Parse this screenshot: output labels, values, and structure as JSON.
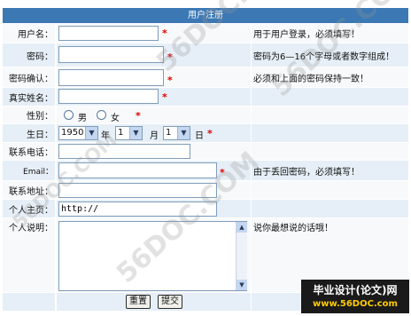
{
  "form": {
    "title": "用户注册"
  },
  "rows": {
    "username": {
      "label": "用户名：",
      "value": "",
      "required": "*",
      "note": "用于用户登录，必须填写！"
    },
    "password": {
      "label": "密码：",
      "value": "",
      "required": "*",
      "note": "密码为6—16个字母或者数字组成！"
    },
    "confirm": {
      "label": "密码确认：",
      "value": "",
      "required": "*",
      "note": "必须和上面的密码保持一致！"
    },
    "realname": {
      "label": "真实姓名：",
      "value": "",
      "required": "*"
    },
    "gender": {
      "label": "性别：",
      "male": "男",
      "female": "女",
      "required": "*"
    },
    "birthday": {
      "label": "生日：",
      "year": "1950",
      "year_unit": "年",
      "month": "1",
      "month_unit": "月",
      "day": "1",
      "day_unit": "日",
      "required": "*"
    },
    "phone": {
      "label": "联系电话：",
      "value": ""
    },
    "email": {
      "label": "Email：",
      "value": "",
      "required": "*",
      "note": "由于丢回密码，必须填写！"
    },
    "address": {
      "label": "联系地址：",
      "value": ""
    },
    "homepage": {
      "label": "个人主页：",
      "value": "http://"
    },
    "bio": {
      "label": "个人说明：",
      "value": "",
      "note": "说你最想说的话哦！"
    }
  },
  "buttons": {
    "reset": "重置",
    "submit": "提交"
  },
  "watermark": {
    "text": "56DOC.COM",
    "logo_line1": "毕业设计(论文)网",
    "logo_line2": "www.56DOC.com"
  },
  "colors": {
    "header": "#3b78b4",
    "row_shade": "#e6eff7",
    "required": "#e00000"
  }
}
